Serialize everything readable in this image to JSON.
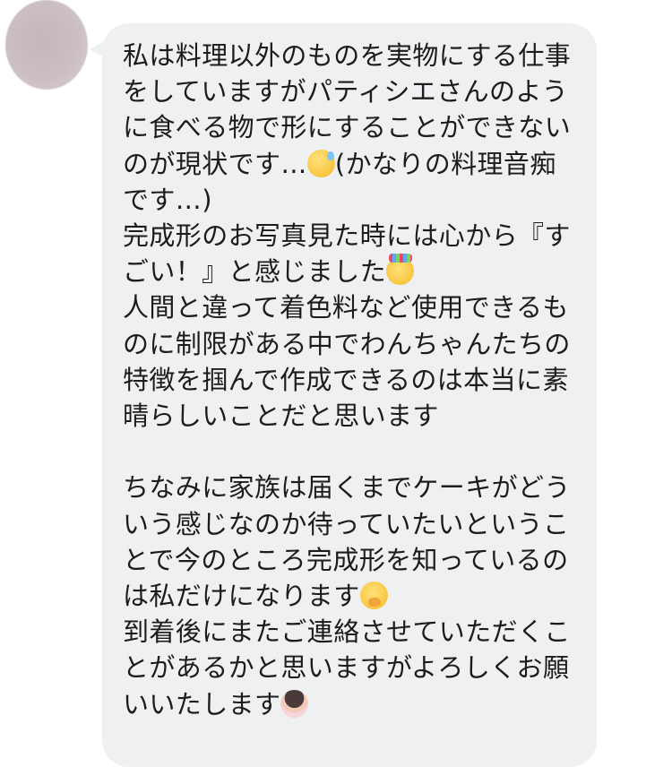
{
  "message": {
    "sender": "",
    "segments": [
      {
        "type": "text",
        "value": "私は料理以外のものを実物にする仕事をしていますがパティシエさんのように食べる物で形にすることができないのが現状です…"
      },
      {
        "type": "emoji",
        "name": "sweating-face-emoji"
      },
      {
        "type": "text",
        "value": "(かなりの料理音痴です…)\n完成形のお写真見た時には心から『すごい！』と感じました"
      },
      {
        "type": "emoji",
        "name": "partying-face-emoji"
      },
      {
        "type": "text",
        "value": "\n人間と違って着色料など使用できるものに制限がある中でわんちゃんたちの特徴を掴んで作成できるのは本当に素晴らしいことだと思います\n\nちなみに家族は届くまでケーキがどういう感じなのか待っていたいということで今のところ完成形を知っているのは私だけになります"
      },
      {
        "type": "emoji",
        "name": "face-with-hand-over-mouth-emoji"
      },
      {
        "type": "text",
        "value": "\n到着後にまたご連絡させていただくことがあるかと思いますがよろしくお願いいたします"
      },
      {
        "type": "emoji",
        "name": "person-bowing-emoji"
      }
    ]
  },
  "colors": {
    "bubble": "#eff0f2",
    "text": "#1c1c1e",
    "background": "#ffffff"
  }
}
